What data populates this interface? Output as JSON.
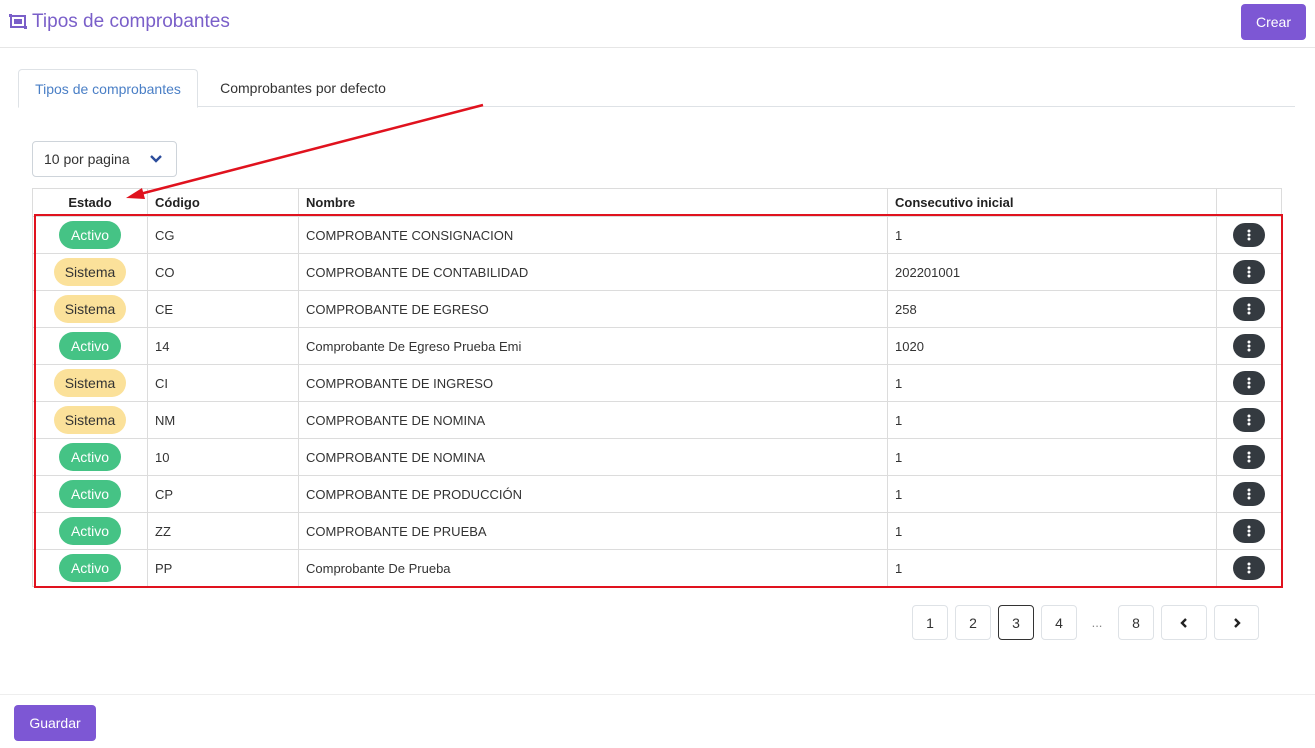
{
  "header": {
    "title": "Tipos de comprobantes",
    "create_label": "Crear",
    "icon": "layers-icon"
  },
  "tabs": [
    {
      "label": "Tipos de comprobantes",
      "active": true
    },
    {
      "label": "Comprobantes por defecto",
      "active": false
    }
  ],
  "per_page": {
    "selected": "10 por pagina"
  },
  "table": {
    "columns": [
      "Estado",
      "Código",
      "Nombre",
      "Consecutivo inicial",
      ""
    ],
    "rows": [
      {
        "estado": "Activo",
        "codigo": "CG",
        "nombre": "COMPROBANTE CONSIGNACION",
        "consecutivo": "1"
      },
      {
        "estado": "Sistema",
        "codigo": "CO",
        "nombre": "COMPROBANTE DE CONTABILIDAD",
        "consecutivo": "202201001"
      },
      {
        "estado": "Sistema",
        "codigo": "CE",
        "nombre": "COMPROBANTE DE EGRESO",
        "consecutivo": "258"
      },
      {
        "estado": "Activo",
        "codigo": "14",
        "nombre": "Comprobante De Egreso Prueba Emi",
        "consecutivo": "1020"
      },
      {
        "estado": "Sistema",
        "codigo": "CI",
        "nombre": "COMPROBANTE DE INGRESO",
        "consecutivo": "1"
      },
      {
        "estado": "Sistema",
        "codigo": "NM",
        "nombre": "COMPROBANTE DE NOMINA",
        "consecutivo": "1"
      },
      {
        "estado": "Activo",
        "codigo": "10",
        "nombre": "COMPROBANTE DE NOMINA",
        "consecutivo": "1"
      },
      {
        "estado": "Activo",
        "codigo": "CP",
        "nombre": "COMPROBANTE DE PRODUCCIÓN",
        "consecutivo": "1"
      },
      {
        "estado": "Activo",
        "codigo": "ZZ",
        "nombre": "COMPROBANTE DE PRUEBA",
        "consecutivo": "1"
      },
      {
        "estado": "Activo",
        "codigo": "PP",
        "nombre": "Comprobante De Prueba",
        "consecutivo": "1"
      }
    ]
  },
  "pagination": {
    "pages": [
      "1",
      "2",
      "3",
      "4"
    ],
    "ellipsis": "...",
    "last": "8",
    "current": "3"
  },
  "footer": {
    "save_label": "Guardar"
  },
  "colors": {
    "brand": "#7d57d4",
    "activo": "#45c385",
    "sistema": "#fbe19a",
    "highlight": "#e0121e"
  }
}
